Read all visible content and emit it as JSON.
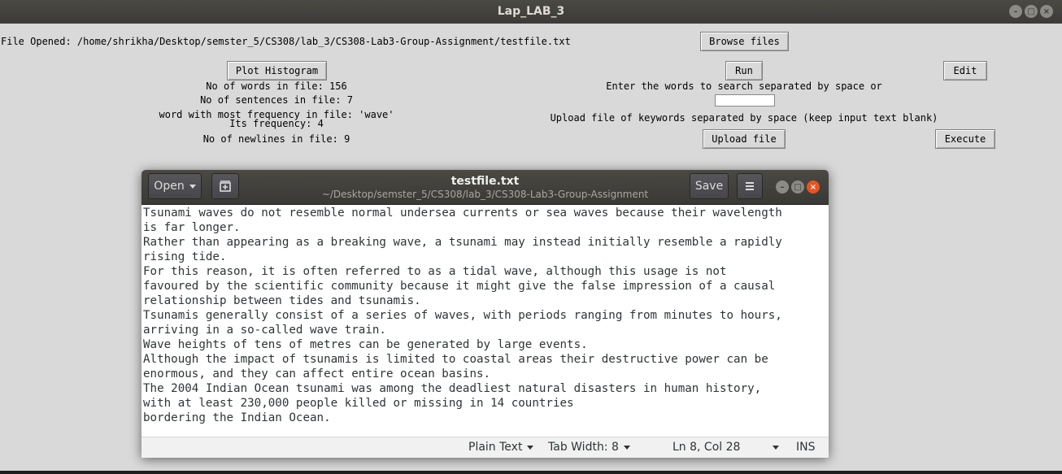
{
  "window": {
    "title": "Lap_LAB_3"
  },
  "file_opened": {
    "label": "File Opened: /home/shrikha/Desktop/semster_5/CS308/lab_3/CS308-Lab3-Group-Assignment/testfile.txt"
  },
  "buttons": {
    "browse": "Browse files",
    "plot": "Plot Histogram",
    "run": "Run",
    "edit": "Edit",
    "upload": "Upload file",
    "execute": "Execute"
  },
  "stats": {
    "words": "No of words in file: 156",
    "sentences": "No of sentences in file: 7",
    "most_freq": "word with most frequency in file: 'wave'",
    "its_freq": "Its frequency: 4",
    "newlines": "No of newlines in file: 9"
  },
  "search": {
    "prompt": "Enter the words to search separated by space or",
    "value": "",
    "upload_hint": "Upload file of keywords separated by space (keep input text blank)"
  },
  "editor": {
    "open_label": "Open",
    "save_label": "Save",
    "title": "testfile.txt",
    "subtitle": "~/Desktop/semster_5/CS308/lab_3/CS308-Lab3-Group-Assignment",
    "lines": [
      "Tsunami waves do not resemble normal undersea currents or sea waves because their wavelength",
      "is far longer.",
      "Rather than appearing as a breaking wave, a tsunami may instead initially resemble a rapidly",
      "rising tide.",
      "For this reason, it is often referred to as a tidal wave, although this usage is not",
      "favoured by the scientific community because it might give the false impression of a causal",
      "relationship between tides and tsunamis.",
      "Tsunamis generally consist of a series of waves, with periods ranging from minutes to hours,",
      "arriving in a so-called wave train.",
      "Wave heights of tens of metres can be generated by large events.",
      "Although the impact of tsunamis is limited to coastal areas their destructive power can be",
      "enormous, and they can affect entire ocean basins.",
      "The 2004 Indian Ocean tsunami was among the deadliest natural disasters in human history,",
      "with at least 230,000 people killed or missing in 14 countries",
      "bordering the Indian Ocean."
    ],
    "status": {
      "syntax": "Plain Text",
      "tab_width": "Tab Width: 8",
      "position": "Ln 8, Col 28",
      "mode": "INS"
    }
  }
}
